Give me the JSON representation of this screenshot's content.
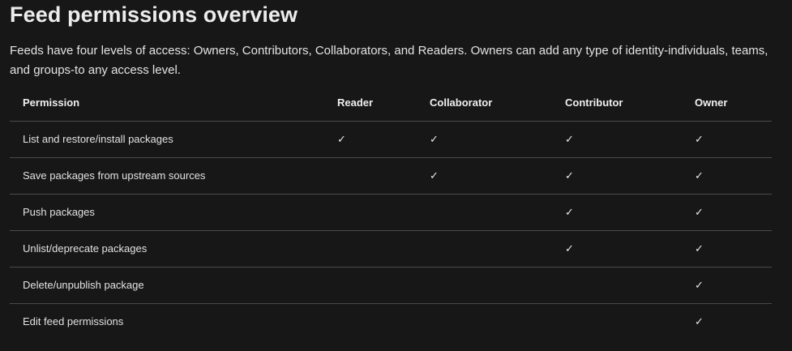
{
  "title": "Feed permissions overview",
  "intro": "Feeds have four levels of access: Owners, Contributors, Collaborators, and Readers. Owners can add any type of identity-individuals, teams, and groups-to any access level.",
  "table": {
    "headers": [
      "Permission",
      "Reader",
      "Collaborator",
      "Contributor",
      "Owner"
    ],
    "check_glyph": "✓",
    "rows": [
      {
        "label": "List and restore/install packages",
        "checks": [
          true,
          true,
          true,
          true
        ]
      },
      {
        "label": "Save packages from upstream sources",
        "checks": [
          false,
          true,
          true,
          true
        ]
      },
      {
        "label": "Push packages",
        "checks": [
          false,
          false,
          true,
          true
        ]
      },
      {
        "label": "Unlist/deprecate packages",
        "checks": [
          false,
          false,
          true,
          true
        ]
      },
      {
        "label": "Delete/unpublish package",
        "checks": [
          false,
          false,
          false,
          true
        ]
      },
      {
        "label": "Edit feed permissions",
        "checks": [
          false,
          false,
          false,
          true
        ]
      }
    ]
  }
}
